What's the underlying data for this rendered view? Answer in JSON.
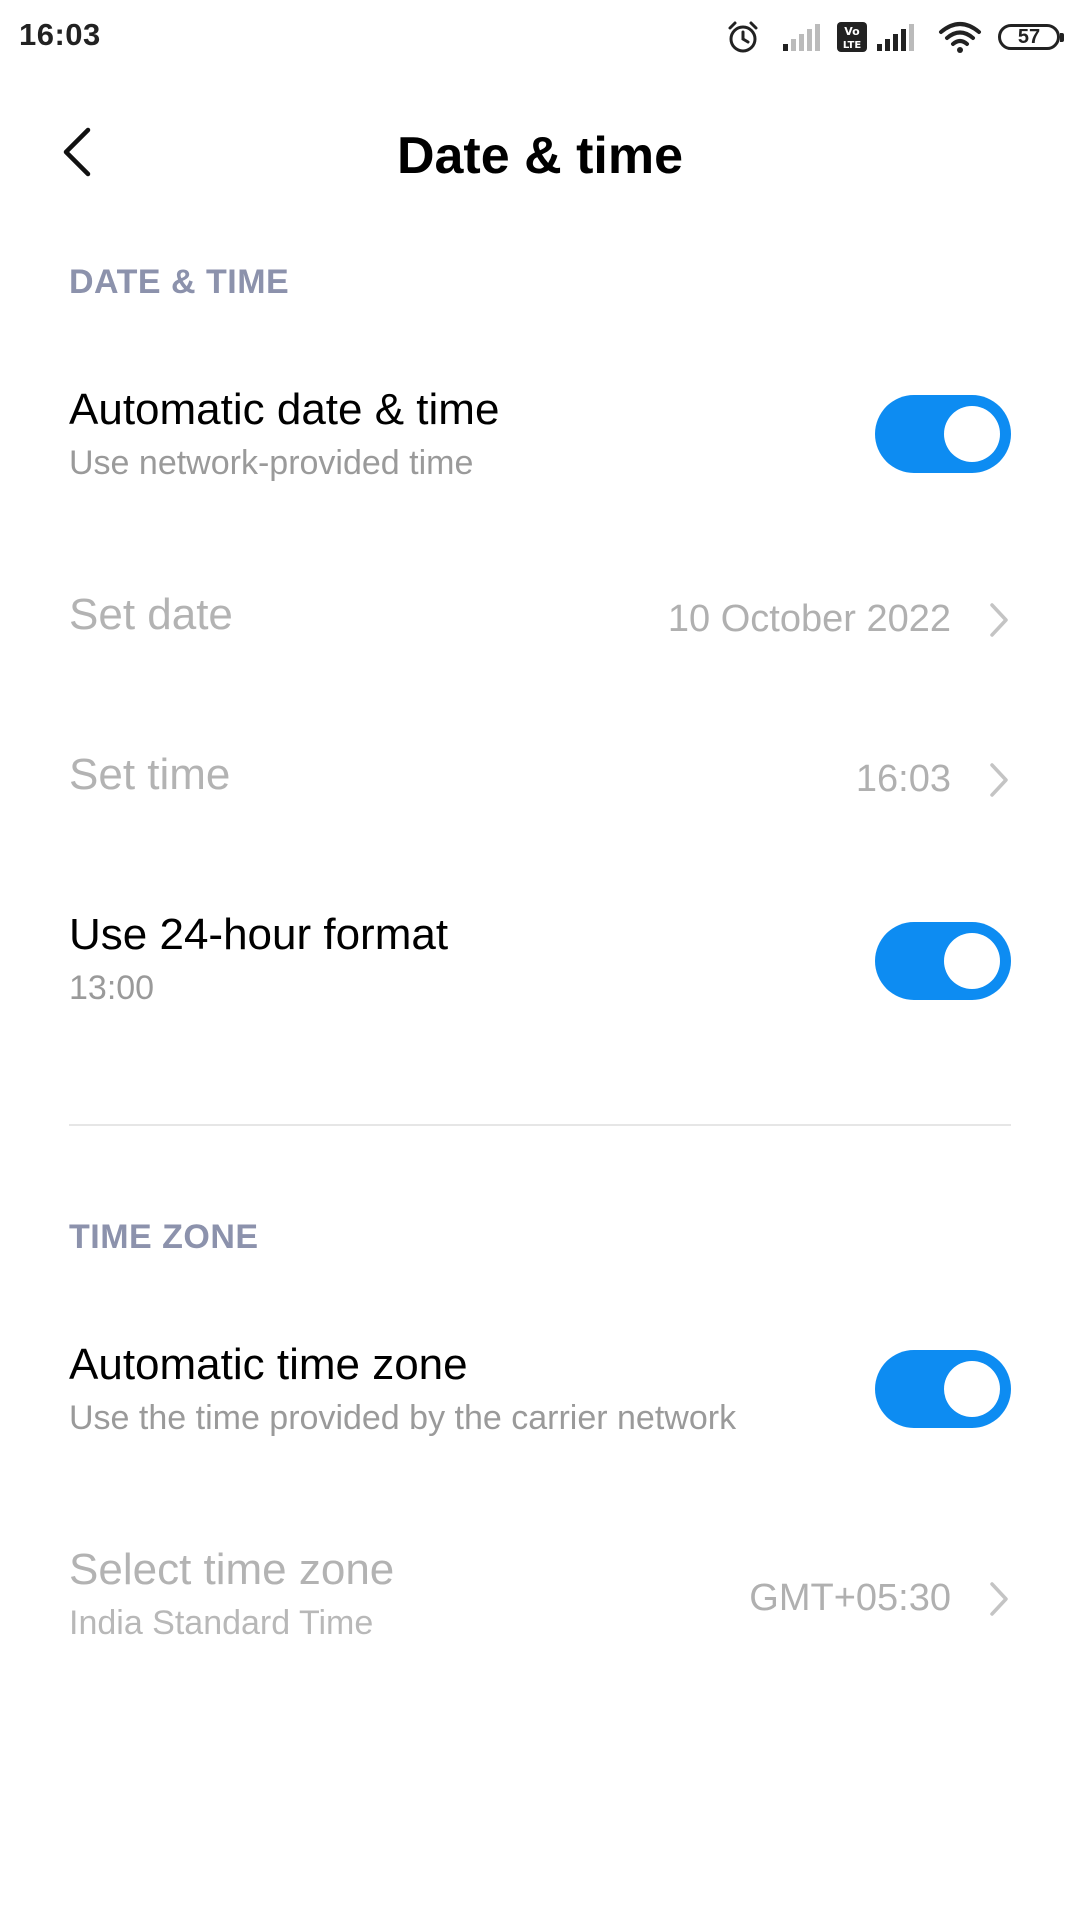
{
  "status_bar": {
    "time": "16:03",
    "battery": "57",
    "icons": [
      "alarm-icon",
      "signal-icon",
      "volte-icon",
      "signal-icon",
      "wifi-icon",
      "battery-icon"
    ]
  },
  "header": {
    "title": "Date & time",
    "back_icon": "chevron-left-icon"
  },
  "sections": {
    "date_time": {
      "label": "DATE & TIME",
      "automatic_date_time": {
        "title": "Automatic date & time",
        "subtitle": "Use network-provided time",
        "enabled": true
      },
      "set_date": {
        "title": "Set date",
        "value": "10 October 2022"
      },
      "set_time": {
        "title": "Set time",
        "value": "16:03"
      },
      "use_24_hour": {
        "title": "Use 24-hour format",
        "subtitle": "13:00",
        "enabled": true
      }
    },
    "time_zone": {
      "label": "TIME ZONE",
      "automatic_time_zone": {
        "title": "Automatic time zone",
        "subtitle": "Use the time provided by the carrier network",
        "enabled": true
      },
      "select_time_zone": {
        "title": "Select time zone",
        "subtitle": "India Standard Time",
        "value": "GMT+05:30"
      }
    }
  },
  "colors": {
    "accent": "#0d8cf2",
    "section_label": "#8c92ac",
    "disabled_text": "#b3b3b3",
    "secondary_text": "#9a9a9a"
  }
}
